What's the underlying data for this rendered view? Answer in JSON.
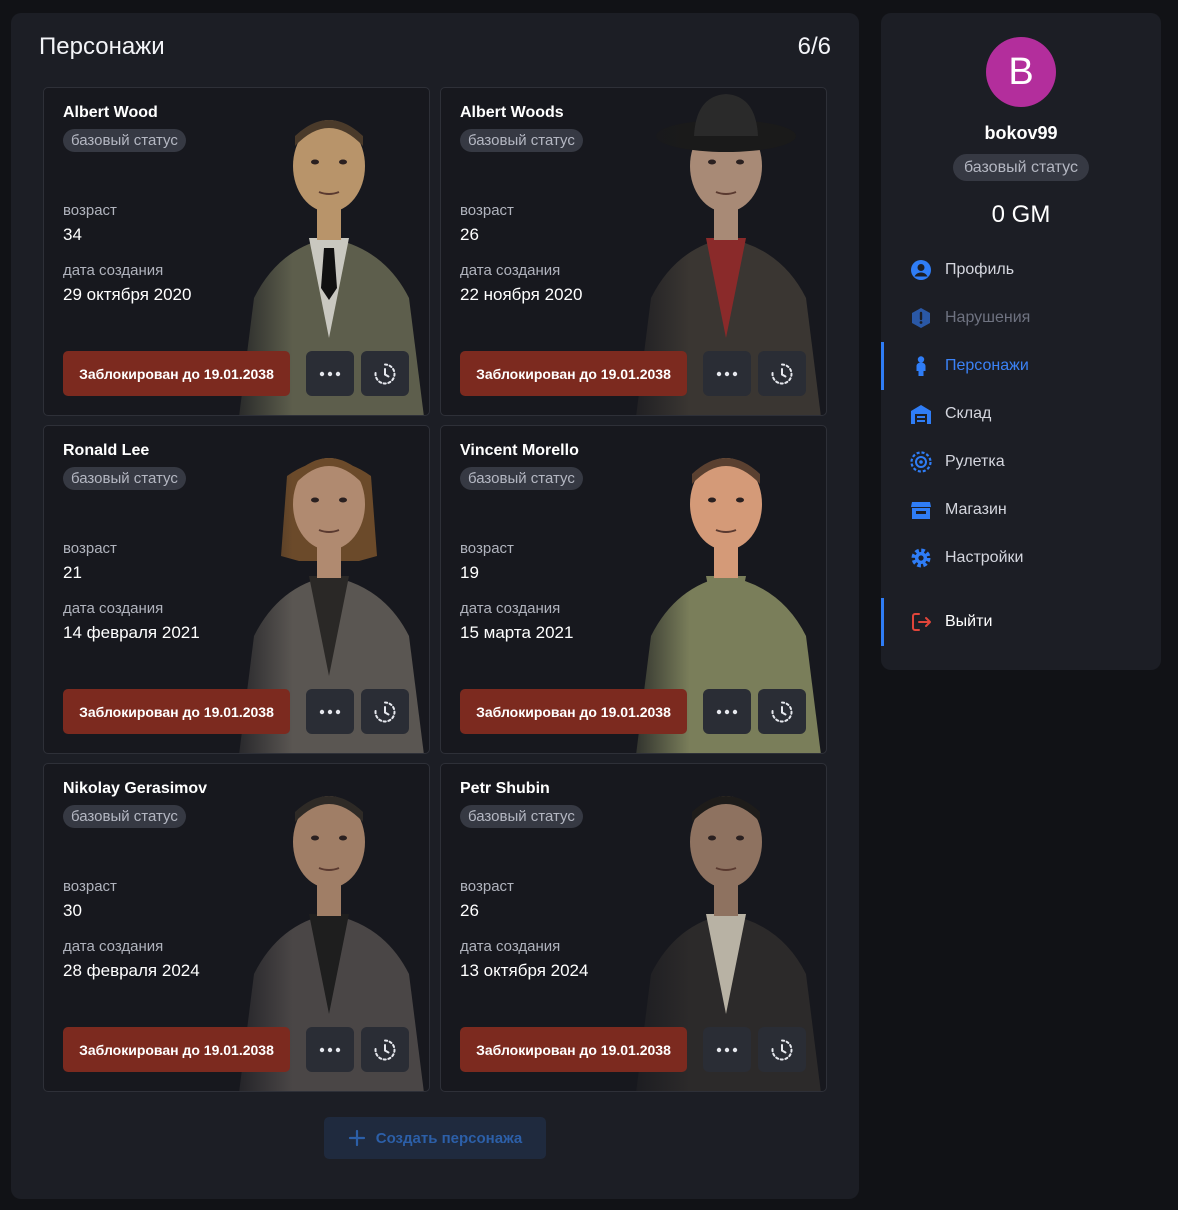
{
  "header": {
    "title": "Персонажи",
    "count": "6/6"
  },
  "characters": [
    {
      "name": "Albert Wood",
      "status": "базовый статус",
      "age_label": "возраст",
      "age": "34",
      "created_label": "дата создания",
      "created": "29 октября 2020",
      "ban": "Заблокирован до 19.01.2038",
      "look": "suit"
    },
    {
      "name": "Albert Woods",
      "status": "базовый статус",
      "age_label": "возраст",
      "age": "26",
      "created_label": "дата создания",
      "created": "22 ноября 2020",
      "ban": "Заблокирован до 19.01.2038",
      "look": "hat"
    },
    {
      "name": "Ronald Lee",
      "status": "базовый статус",
      "age_label": "возраст",
      "age": "21",
      "created_label": "дата создания",
      "created": "14 февраля 2021",
      "ban": "Заблокирован до 19.01.2038",
      "look": "longhair"
    },
    {
      "name": "Vincent Morello",
      "status": "базовый статус",
      "age_label": "возраст",
      "age": "19",
      "created_label": "дата создания",
      "created": "15 марта 2021",
      "ban": "Заблокирован до 19.01.2038",
      "look": "green"
    },
    {
      "name": "Nikolay Gerasimov",
      "status": "базовый статус",
      "age_label": "возраст",
      "age": "30",
      "created_label": "дата создания",
      "created": "28 февраля 2024",
      "ban": "Заблокирован до 19.01.2038",
      "look": "jacket"
    },
    {
      "name": "Petr Shubin",
      "status": "базовый статус",
      "age_label": "возраст",
      "age": "26",
      "created_label": "дата создания",
      "created": "13 октября 2024",
      "ban": "Заблокирован до 19.01.2038",
      "look": "bomber"
    }
  ],
  "card_actions": {
    "more_icon": "more-dots-icon",
    "history_icon": "history-clock-icon"
  },
  "create_button": {
    "label": "Создать персонажа",
    "icon": "plus-icon"
  },
  "profile": {
    "avatar_letter": "B",
    "avatar_color": "#b32e9c",
    "username": "bokov99",
    "status": "базовый статус",
    "balance": "0 GM"
  },
  "nav": [
    {
      "label": "Профиль",
      "icon": "user-circle-icon",
      "state": "normal"
    },
    {
      "label": "Нарушения",
      "icon": "warning-hexagon-icon",
      "state": "muted"
    },
    {
      "label": "Персонажи",
      "icon": "person-icon",
      "state": "active"
    },
    {
      "label": "Склад",
      "icon": "warehouse-icon",
      "state": "normal"
    },
    {
      "label": "Рулетка",
      "icon": "roulette-icon",
      "state": "normal"
    },
    {
      "label": "Магазин",
      "icon": "store-icon",
      "state": "normal"
    },
    {
      "label": "Настройки",
      "icon": "gear-icon",
      "state": "normal"
    }
  ],
  "logout": {
    "label": "Выйти",
    "icon": "logout-icon"
  },
  "colors": {
    "accent": "#2f7df6",
    "ban": "#7c2a1f",
    "logout": "#e0453a",
    "panel": "#1c1e25"
  }
}
